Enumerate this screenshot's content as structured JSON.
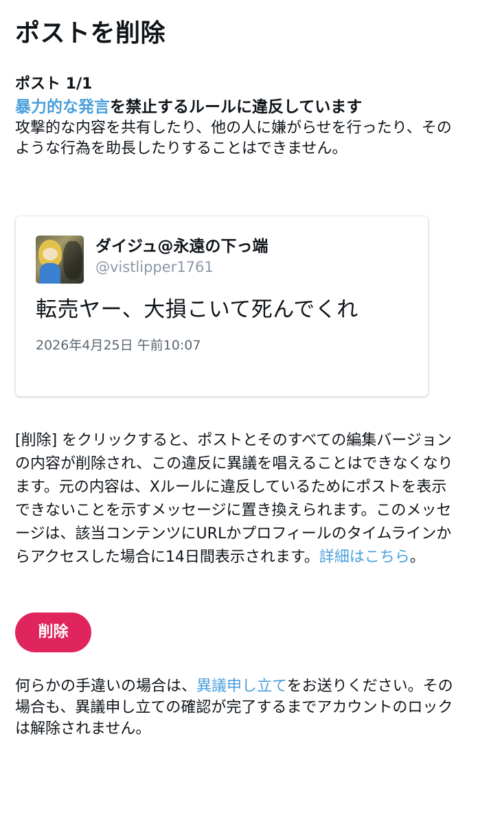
{
  "header": {
    "title": "ポストを削除"
  },
  "violation": {
    "post_count": "ポスト 1/1",
    "rule_link": "暴力的な発言",
    "rule_suffix": "を禁止するルールに違反しています",
    "description": "攻撃的な内容を共有したり、他の人に嫌がらせを行ったり、そのような行為を助長したりすることはできません。"
  },
  "post": {
    "display_name": "ダイジュ@永遠の下っ端",
    "handle": "@vistlipper1761",
    "text": "転売ヤー、大損こいて死んでくれ",
    "date": "2026年4月25日 午前10:07"
  },
  "explanation": {
    "text": "[削除] をクリックすると、ポストとそのすべての編集バージョンの内容が削除され、この違反に異議を唱えることはできなくなります。元の内容は、Xルールに違反しているためにポストを表示できないことを示すメッセージに置き換えられます。このメッセージは、該当コンテンツにURLかプロフィールのタイムラインからアクセスした場合に14日間表示されます。",
    "link": "詳細はこちら",
    "end": "。"
  },
  "actions": {
    "delete_label": "削除"
  },
  "appeal": {
    "prefix": "何らかの手違いの場合は、",
    "link": "異議申し立て",
    "suffix": "をお送りください。その場合も、異議申し立ての確認が完了するまでアカウントのロックは解除されません。"
  },
  "colors": {
    "link": "#4a9fdc",
    "delete_button": "#e0245e",
    "secondary_text": "#8b98a5"
  }
}
